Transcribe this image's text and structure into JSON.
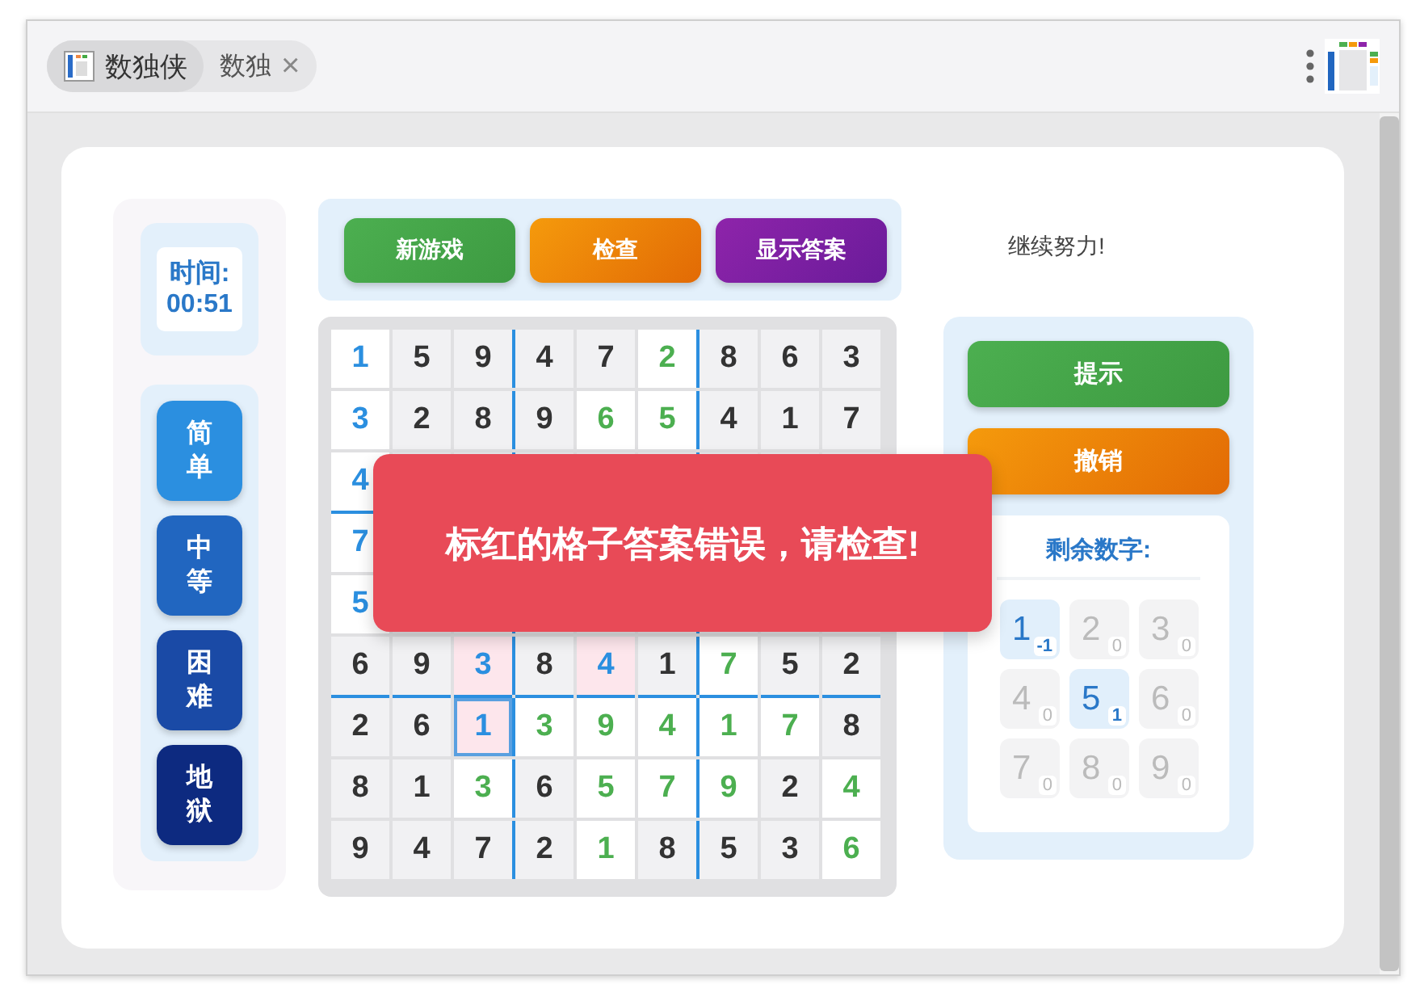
{
  "tabs": [
    {
      "label": "数独侠",
      "selected": true,
      "kind": "app"
    },
    {
      "label": "数独",
      "selected": false,
      "kind": "page",
      "close": "×"
    }
  ],
  "timer": {
    "label": "时间:",
    "value": "00:51"
  },
  "difficulty": [
    {
      "label": "简单",
      "color": "#2b8fe0"
    },
    {
      "label": "中等",
      "color": "#2166c0"
    },
    {
      "label": "困难",
      "color": "#1a4aa6"
    },
    {
      "label": "地狱",
      "color": "#0d2a80"
    }
  ],
  "toolbar": [
    {
      "label": "新游戏",
      "kind": "green"
    },
    {
      "label": "检查",
      "kind": "orange"
    },
    {
      "label": "显示答案",
      "kind": "purple"
    }
  ],
  "status": "继续努力!",
  "grid": {
    "rows": [
      {
        "cells": [
          {
            "value": "1",
            "kind": "entered",
            "selected": false
          },
          {
            "value": "5",
            "kind": "given",
            "selected": false
          },
          {
            "value": "9",
            "kind": "given",
            "selected": false
          },
          {
            "value": "4",
            "kind": "given",
            "selected": false
          },
          {
            "value": "7",
            "kind": "given",
            "selected": false
          },
          {
            "value": "2",
            "kind": "correct",
            "selected": false
          },
          {
            "value": "8",
            "kind": "given",
            "selected": false
          },
          {
            "value": "6",
            "kind": "given",
            "selected": false
          },
          {
            "value": "3",
            "kind": "given",
            "selected": false
          }
        ]
      },
      {
        "cells": [
          {
            "value": "3",
            "kind": "entered",
            "selected": false
          },
          {
            "value": "2",
            "kind": "given",
            "selected": false
          },
          {
            "value": "8",
            "kind": "given",
            "selected": false
          },
          {
            "value": "9",
            "kind": "given",
            "selected": false
          },
          {
            "value": "6",
            "kind": "correct",
            "selected": false
          },
          {
            "value": "5",
            "kind": "correct",
            "selected": false
          },
          {
            "value": "4",
            "kind": "given",
            "selected": false
          },
          {
            "value": "1",
            "kind": "given",
            "selected": false
          },
          {
            "value": "7",
            "kind": "given",
            "selected": false
          }
        ]
      },
      {
        "cells": [
          {
            "value": "4",
            "kind": "entered",
            "selected": false
          },
          {
            "kind": "covered"
          },
          {
            "kind": "covered"
          },
          {
            "kind": "covered"
          },
          {
            "kind": "covered"
          },
          {
            "kind": "covered"
          },
          {
            "kind": "covered"
          },
          {
            "kind": "covered"
          },
          {
            "kind": "covered"
          }
        ]
      },
      {
        "cells": [
          {
            "value": "7",
            "kind": "entered",
            "selected": false
          },
          {
            "kind": "covered"
          },
          {
            "kind": "covered"
          },
          {
            "kind": "covered"
          },
          {
            "kind": "covered"
          },
          {
            "kind": "covered"
          },
          {
            "kind": "covered"
          },
          {
            "kind": "covered"
          },
          {
            "kind": "covered"
          }
        ]
      },
      {
        "cells": [
          {
            "value": "5",
            "kind": "entered",
            "selected": false
          },
          {
            "kind": "covered"
          },
          {
            "kind": "covered"
          },
          {
            "kind": "covered"
          },
          {
            "kind": "covered"
          },
          {
            "kind": "covered"
          },
          {
            "kind": "covered"
          },
          {
            "kind": "covered"
          },
          {
            "kind": "covered"
          }
        ]
      },
      {
        "cells": [
          {
            "value": "6",
            "kind": "given",
            "selected": false
          },
          {
            "value": "9",
            "kind": "given",
            "selected": false
          },
          {
            "value": "3",
            "kind": "wrong",
            "selected": false
          },
          {
            "value": "8",
            "kind": "given",
            "selected": false
          },
          {
            "value": "4",
            "kind": "wrong",
            "selected": false
          },
          {
            "value": "1",
            "kind": "given",
            "selected": false
          },
          {
            "value": "7",
            "kind": "correct",
            "selected": false
          },
          {
            "value": "5",
            "kind": "given",
            "selected": false
          },
          {
            "value": "2",
            "kind": "given",
            "selected": false
          }
        ]
      },
      {
        "cells": [
          {
            "value": "2",
            "kind": "given",
            "selected": false
          },
          {
            "value": "6",
            "kind": "given",
            "selected": false
          },
          {
            "value": "1",
            "kind": "wrong",
            "selected": true
          },
          {
            "value": "3",
            "kind": "correct",
            "selected": false
          },
          {
            "value": "9",
            "kind": "correct",
            "selected": false
          },
          {
            "value": "4",
            "kind": "correct",
            "selected": false
          },
          {
            "value": "1",
            "kind": "correct",
            "selected": false
          },
          {
            "value": "7",
            "kind": "correct",
            "selected": false
          },
          {
            "value": "8",
            "kind": "given",
            "selected": false
          }
        ]
      },
      {
        "cells": [
          {
            "value": "8",
            "kind": "given",
            "selected": false
          },
          {
            "value": "1",
            "kind": "given",
            "selected": false
          },
          {
            "value": "3",
            "kind": "correct",
            "selected": false
          },
          {
            "value": "6",
            "kind": "given",
            "selected": false
          },
          {
            "value": "5",
            "kind": "correct",
            "selected": false
          },
          {
            "value": "7",
            "kind": "correct",
            "selected": false
          },
          {
            "value": "9",
            "kind": "correct",
            "selected": false
          },
          {
            "value": "2",
            "kind": "given",
            "selected": false
          },
          {
            "value": "4",
            "kind": "correct",
            "selected": false
          }
        ]
      },
      {
        "cells": [
          {
            "value": "9",
            "kind": "given",
            "selected": false
          },
          {
            "value": "4",
            "kind": "given",
            "selected": false
          },
          {
            "value": "7",
            "kind": "given",
            "selected": false
          },
          {
            "value": "2",
            "kind": "given",
            "selected": false
          },
          {
            "value": "1",
            "kind": "correct",
            "selected": false
          },
          {
            "value": "8",
            "kind": "given",
            "selected": false
          },
          {
            "value": "5",
            "kind": "given",
            "selected": false
          },
          {
            "value": "3",
            "kind": "given",
            "selected": false
          },
          {
            "value": "6",
            "kind": "correct",
            "selected": false
          }
        ]
      }
    ]
  },
  "actions": [
    {
      "label": "提示",
      "kind": "green"
    },
    {
      "label": "撤销",
      "kind": "orange"
    }
  ],
  "remaining": {
    "title": "剩余数字:",
    "numbers": [
      {
        "digit": "1",
        "count": "-1",
        "active": true
      },
      {
        "digit": "2",
        "count": "0",
        "active": false
      },
      {
        "digit": "3",
        "count": "0",
        "active": false
      },
      {
        "digit": "4",
        "count": "0",
        "active": false
      },
      {
        "digit": "5",
        "count": "1",
        "active": true
      },
      {
        "digit": "6",
        "count": "0",
        "active": false
      },
      {
        "digit": "7",
        "count": "0",
        "active": false
      },
      {
        "digit": "8",
        "count": "0",
        "active": false
      },
      {
        "digit": "9",
        "count": "0",
        "active": false
      }
    ]
  },
  "toast": "标红的格子答案错误，请检查!"
}
